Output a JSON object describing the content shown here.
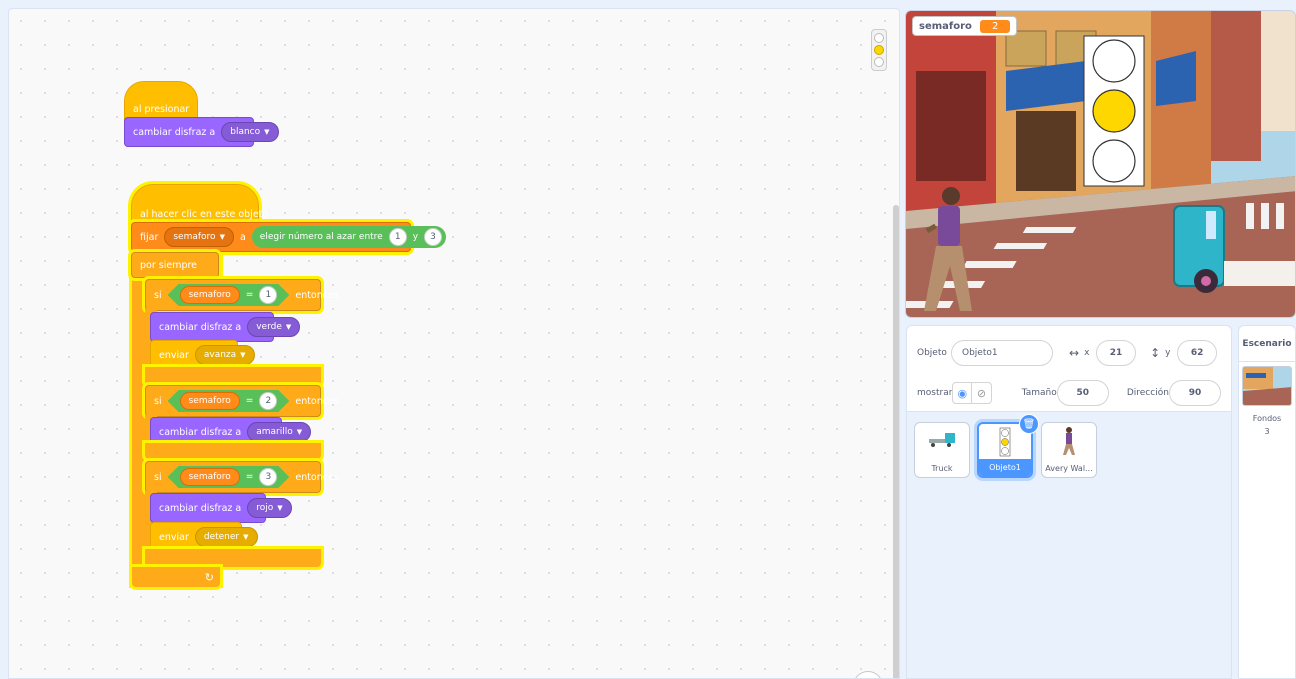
{
  "blocks": {
    "green_flag": {
      "text": "al presionar"
    },
    "switch_costume_1": {
      "text": "cambiar disfraz a",
      "value": "blanco"
    },
    "sprite_clicked": {
      "text": "al hacer clic en este objeto"
    },
    "set_var": {
      "text": "fijar",
      "variable": "semaforo",
      "to": "a",
      "random_text": "elegir número al azar entre",
      "random_from": "1",
      "random_and": "y",
      "random_to": "3"
    },
    "forever": {
      "text": "por siempre"
    },
    "if1": {
      "if": "si",
      "variable": "semaforo",
      "operator": "=",
      "value": "1",
      "then": "entonces"
    },
    "if1_costume": {
      "text": "cambiar disfraz a",
      "value": "verde"
    },
    "if1_broadcast": {
      "text": "enviar",
      "value": "avanza"
    },
    "if2": {
      "if": "si",
      "variable": "semaforo",
      "operator": "=",
      "value": "2",
      "then": "entonces"
    },
    "if2_costume": {
      "text": "cambiar disfraz a",
      "value": "amarillo"
    },
    "if3": {
      "if": "si",
      "variable": "semaforo",
      "operator": "=",
      "value": "3",
      "then": "entonces"
    },
    "if3_costume": {
      "text": "cambiar disfraz a",
      "value": "rojo"
    },
    "if3_broadcast": {
      "text": "enviar",
      "value": "detener"
    }
  },
  "stage": {
    "monitor_name": "semaforo",
    "monitor_value": "2",
    "colors": {
      "light_on": "#ffd700",
      "sky": "#aed6e8",
      "road": "#a86454"
    }
  },
  "sprite_info": {
    "sprite_label": "Objeto",
    "sprite_name": "Objeto1",
    "x_label": "x",
    "x_value": "21",
    "y_label": "y",
    "y_value": "62",
    "show_label": "mostrar",
    "size_label": "Tamaño",
    "size_value": "50",
    "direction_label": "Dirección",
    "direction_value": "90"
  },
  "sprites": [
    {
      "name": "Truck",
      "icon": "truck-icon"
    },
    {
      "name": "Objeto1",
      "icon": "traffic-light-icon",
      "selected": true
    },
    {
      "name": "Avery Wal...",
      "icon": "walking-person-icon"
    }
  ],
  "backdrop": {
    "title": "Escenario",
    "backdrops_label": "Fondos",
    "backdrops_count": "3"
  }
}
